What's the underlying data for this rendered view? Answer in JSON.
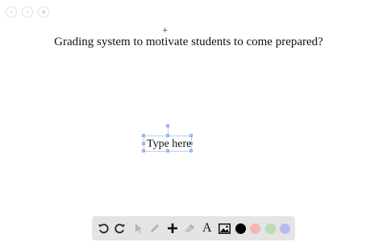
{
  "nav": {
    "back_icon": "chevron-left-icon",
    "forward_icon": "chevron-right-icon",
    "add_icon": "plus-icon"
  },
  "canvas": {
    "question_text": "Grading system to motivate students to come prepared?",
    "textbox_text": "Type here"
  },
  "toolbar": {
    "tools": [
      "undo-icon",
      "redo-icon",
      "pointer-icon",
      "pen-icon",
      "plus-icon",
      "eraser-icon",
      "text-icon",
      "image-icon"
    ],
    "text_tool_glyph": "A",
    "colors": {
      "black": "#000000",
      "red": "#f4b6b6",
      "green": "#b9dcb3",
      "blue": "#b5b9ee"
    }
  }
}
